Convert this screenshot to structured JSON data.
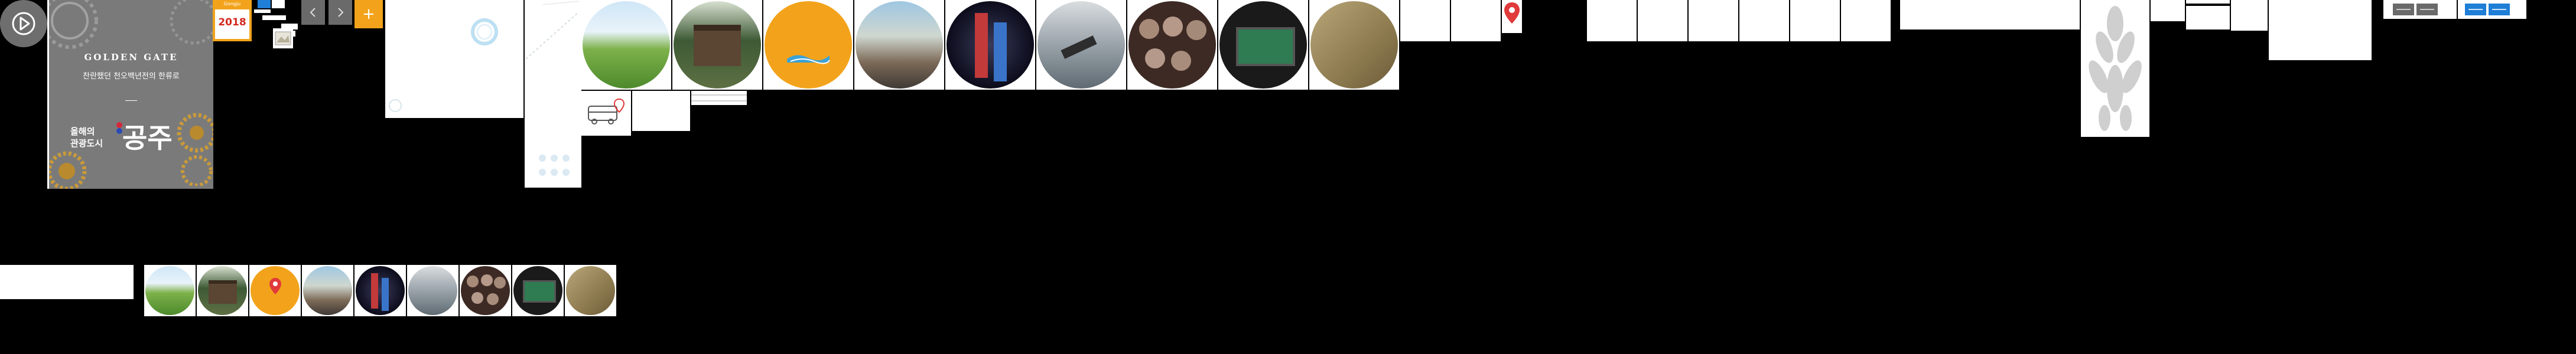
{
  "banner": {
    "title": "GOLDEN GATE",
    "subtitle": "찬란했던 천오백년전의 한류로",
    "city_prefix": "올해의",
    "city_suffix": "관광도시",
    "city_name": "공주"
  },
  "year_badge": {
    "top": "Gongju",
    "year": "2018"
  },
  "controls": {
    "play_icon": "play-icon",
    "prev_icon": "chevron-left-icon",
    "next_icon": "chevron-right-icon",
    "plus_label": "+"
  },
  "colors": {
    "background": "#000000",
    "banner_bg": "#7a7a7a",
    "accent_orange": "#f2a31b",
    "control_grey": "#6a6a6a",
    "accent_blue": "#1f7ed6",
    "pin_red": "#e03a3a"
  },
  "circles": [
    {
      "name": "circle-green-hill"
    },
    {
      "name": "circle-temple-gate"
    },
    {
      "name": "circle-orange-wave"
    },
    {
      "name": "circle-street-festival"
    },
    {
      "name": "circle-costume-performers"
    },
    {
      "name": "circle-telescope-view"
    },
    {
      "name": "circle-artifacts-plates"
    },
    {
      "name": "circle-screen-display"
    },
    {
      "name": "circle-terrain-model"
    }
  ]
}
